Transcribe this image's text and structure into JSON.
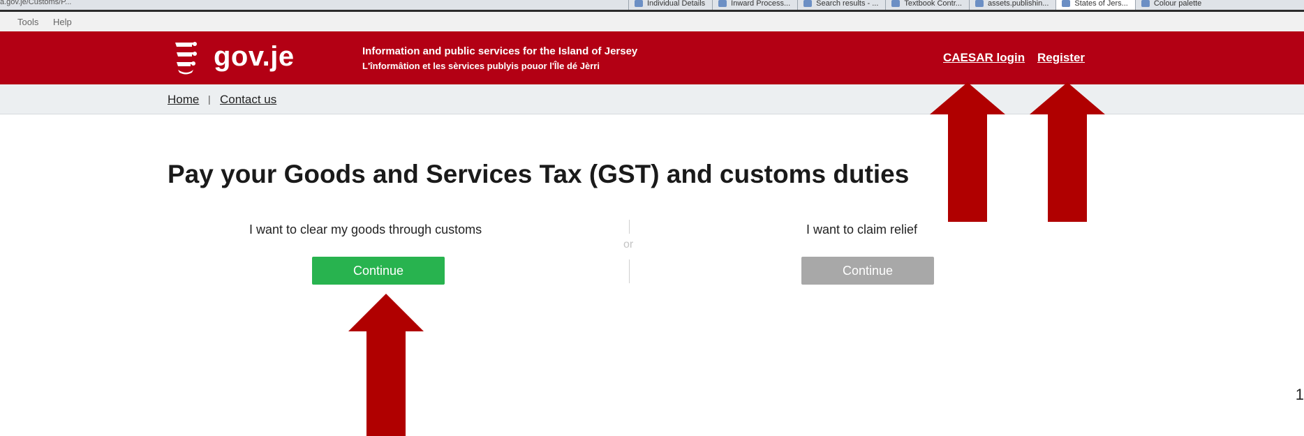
{
  "browser": {
    "url_fragment": "a.gov.je/Customs/P...",
    "tabs": [
      "Individual Details",
      "Inward Process...",
      "Search results - ...",
      "Textbook Contr...",
      "assets.publishin...",
      "States of Jers...",
      "Colour palette"
    ]
  },
  "menu": {
    "tools": "Tools",
    "help": "Help"
  },
  "header": {
    "logo_text": "gov.je",
    "tagline_en": "Information and public services for the Island of Jersey",
    "tagline_jer": "L'înformâtion et les sèrvices publyis pouor l'Île dé Jèrri",
    "login_link": "CAESAR login",
    "register_link": "Register",
    "bg_color": "#b30014"
  },
  "breadcrumb": {
    "home": "Home",
    "separator": "|",
    "contact": "Contact us"
  },
  "main": {
    "title": "Pay your Goods and Services Tax (GST) and customs duties",
    "left_option": {
      "label": "I want to clear my goods through customs",
      "button": "Continue"
    },
    "or_text": "or",
    "right_option": {
      "label": "I want to claim relief",
      "button": "Continue"
    }
  },
  "colors": {
    "primary_button": "#28b34f",
    "disabled_button": "#a8a8a8",
    "annotation_arrow": "#b00000"
  },
  "page_number": "1"
}
